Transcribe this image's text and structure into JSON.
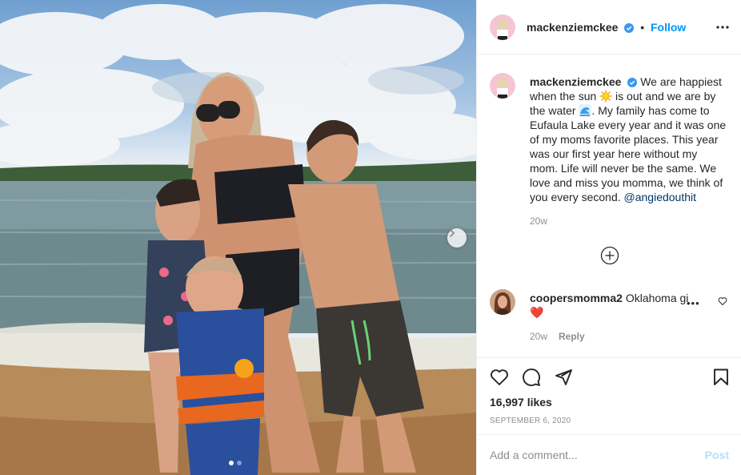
{
  "header": {
    "username": "mackenziemckee",
    "separator": "•",
    "follow_label": "Follow"
  },
  "caption": {
    "username": "mackenziemckee",
    "text_part1": "We are happiest when the sun ",
    "text_part2": " is out and we are by the water ",
    "text_part3": ". My family has come to Eufaula Lake every year and it was one of my moms favorite places. This year was our first year here without my mom. Life will never be the same. We love and miss you momma, we think of you every second. ",
    "mention": "@angiedouthit",
    "time": "20w"
  },
  "comment": {
    "username": "coopersmomma2",
    "text": "Oklahoma gi",
    "heart_emoji": "❤️",
    "time": "20w",
    "reply_label": "Reply"
  },
  "footer": {
    "likes": "16,997 likes",
    "date": "SEPTEMBER 6, 2020"
  },
  "add_comment": {
    "placeholder": "Add a comment...",
    "post_label": "Post"
  },
  "carousel": {
    "total": 2,
    "active": 1
  },
  "colors": {
    "accent": "#0095f6",
    "verified": "#3897f0",
    "text": "#262626",
    "muted": "#8e8e8e"
  }
}
